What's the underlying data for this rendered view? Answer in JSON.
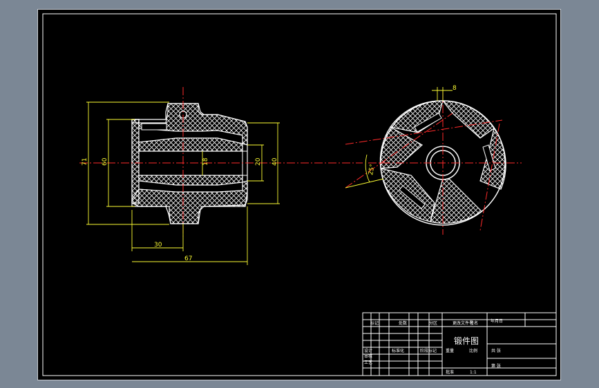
{
  "drawing": {
    "colors": {
      "background": "#000000",
      "frame": "#ffffff",
      "outline": "#ffffff",
      "centerline": "#ff2a2a",
      "dimension": "#ffff33",
      "hatch": "#ffffff"
    },
    "front_view": {
      "dimensions": {
        "overall_height": "71",
        "inner_height": "60",
        "bore": "18",
        "boss_inner": "20",
        "boss_outer": "40",
        "left_length": "30",
        "total_length": "67"
      }
    },
    "side_view": {
      "dimensions": {
        "slot_width": "8",
        "angle": "25°"
      }
    },
    "title_block": {
      "title": "锻件图",
      "row_labels": [
        "标记",
        "处数",
        "分区",
        "更改文件号",
        "签名",
        "年月日"
      ],
      "lower_left": [
        "设计",
        "审核",
        "工艺"
      ],
      "cells": [
        "标准化",
        "阶段标记",
        "重量",
        "比例"
      ],
      "scale_label": "1:1",
      "sheet_labels": [
        "共 张",
        "第 张"
      ],
      "approve": "批准"
    }
  }
}
